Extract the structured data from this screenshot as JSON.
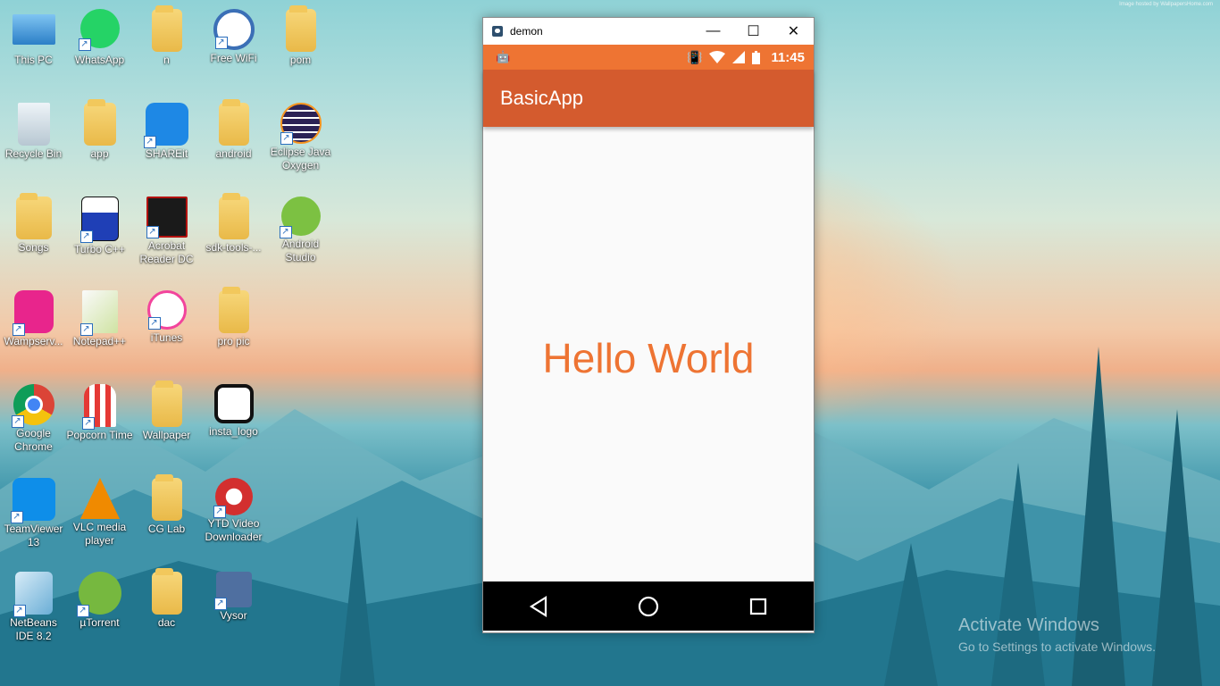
{
  "wallpaper_credit": "Image hosted by WallpapersHome.com",
  "desktop": {
    "icons": [
      {
        "label": "This PC",
        "icon": "computer-icon"
      },
      {
        "label": "WhatsApp",
        "icon": "whatsapp-icon"
      },
      {
        "label": "n",
        "icon": "folder-icon"
      },
      {
        "label": "Free WiFi",
        "icon": "wifi-icon"
      },
      {
        "label": "pom",
        "icon": "pdf-file-icon"
      },
      {
        "label": "Recycle Bin",
        "icon": "recycle-bin-icon"
      },
      {
        "label": "app",
        "icon": "folder-icon"
      },
      {
        "label": "SHAREit",
        "icon": "shareit-icon"
      },
      {
        "label": "android",
        "icon": "folder-icon"
      },
      {
        "label": "Eclipse Java Oxygen",
        "icon": "eclipse-icon"
      },
      {
        "label": "Songs",
        "icon": "folder-icon"
      },
      {
        "label": "Turbo C++",
        "icon": "turbo-cpp-icon"
      },
      {
        "label": "Acrobat Reader DC",
        "icon": "acrobat-icon"
      },
      {
        "label": "sdk-tools-...",
        "icon": "folder-icon"
      },
      {
        "label": "Android Studio",
        "icon": "android-studio-icon"
      },
      {
        "label": "Wampserv...",
        "icon": "wampserver-icon"
      },
      {
        "label": "Notepad++",
        "icon": "notepadpp-icon"
      },
      {
        "label": "iTunes",
        "icon": "itunes-icon"
      },
      {
        "label": "pro pic",
        "icon": "folder-icon"
      },
      {
        "label": "Google Chrome",
        "icon": "chrome-icon"
      },
      {
        "label": "Popcorn Time",
        "icon": "popcorn-icon"
      },
      {
        "label": "Wallpaper",
        "icon": "folder-icon"
      },
      {
        "label": "insta_logo",
        "icon": "instagram-icon"
      },
      {
        "label": "TeamViewer 13",
        "icon": "teamviewer-icon"
      },
      {
        "label": "VLC media player",
        "icon": "vlc-icon"
      },
      {
        "label": "CG Lab",
        "icon": "folder-icon"
      },
      {
        "label": "YTD Video Downloader",
        "icon": "ytd-icon"
      },
      {
        "label": "NetBeans IDE 8.2",
        "icon": "netbeans-icon"
      },
      {
        "label": "µTorrent",
        "icon": "utorrent-icon"
      },
      {
        "label": "dac",
        "icon": "folder-icon"
      },
      {
        "label": "Vysor",
        "icon": "vysor-icon"
      }
    ]
  },
  "window": {
    "title": "demon",
    "minimize": "—",
    "maximize": "☐",
    "close": "✕"
  },
  "phone": {
    "status_time": "11:45",
    "app_title": "BasicApp",
    "content_text": "Hello World",
    "accent_color": "#ee7433",
    "appbar_color": "#d45b2e"
  },
  "activation": {
    "title": "Activate Windows",
    "subtitle": "Go to Settings to activate Windows."
  }
}
